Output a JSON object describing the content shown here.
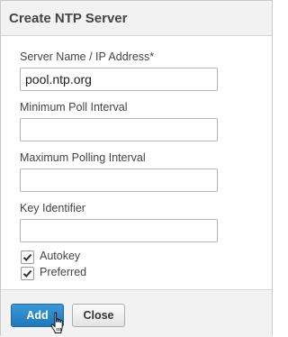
{
  "dialog": {
    "title": "Create NTP Server"
  },
  "fields": {
    "server_name": {
      "label": "Server Name / IP Address*",
      "value": "pool.ntp.org"
    },
    "min_poll": {
      "label": "Minimum Poll Interval",
      "value": ""
    },
    "max_poll": {
      "label": "Maximum Polling Interval",
      "value": ""
    },
    "key_id": {
      "label": "Key Identifier",
      "value": ""
    }
  },
  "options": {
    "autokey": {
      "label": "Autokey",
      "checked": true
    },
    "preferred": {
      "label": "Preferred",
      "checked": true
    }
  },
  "buttons": {
    "add_label": "Add",
    "close_label": "Close"
  },
  "colors": {
    "primary_button": "#2a87c9",
    "header_background": "#f2f2f2"
  },
  "icons": {
    "checkbox": "checkmark-icon",
    "pointer": "hand-pointer-icon"
  }
}
